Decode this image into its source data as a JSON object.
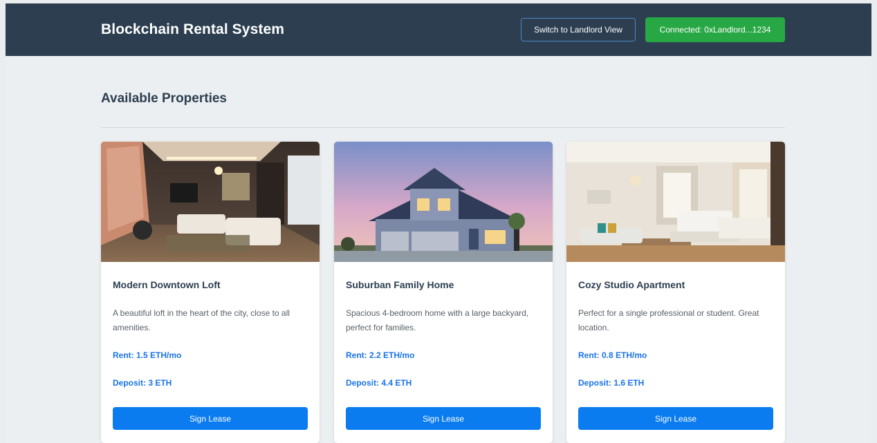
{
  "header": {
    "brand": "Blockchain Rental System",
    "switch_view_label": "Switch to Landlord View",
    "connection_status": "Connected: 0xLandlord...1234"
  },
  "main": {
    "section_title": "Available Properties",
    "properties": [
      {
        "title": "Modern Downtown Loft",
        "description": "A beautiful loft in the heart of the city, close to all amenities.",
        "rent": "Rent: 1.5 ETH/mo",
        "deposit": "Deposit: 3 ETH",
        "button_label": "Sign Lease",
        "image": "living-room-photo"
      },
      {
        "title": "Suburban Family Home",
        "description": "Spacious 4-bedroom home with a large backyard, perfect for families.",
        "rent": "Rent: 2.2 ETH/mo",
        "deposit": "Deposit: 4.4 ETH",
        "button_label": "Sign Lease",
        "image": "house-exterior-photo"
      },
      {
        "title": "Cozy Studio Apartment",
        "description": "Perfect for a single professional or student. Great location.",
        "rent": "Rent: 0.8 ETH/mo",
        "deposit": "Deposit: 1.6 ETH",
        "button_label": "Sign Lease",
        "image": "studio-bedroom-photo"
      }
    ]
  },
  "colors": {
    "navbar": "#2c3e50",
    "status_green": "#28a745",
    "accent_blue": "#1a73e8",
    "button_blue": "#0a7cf0",
    "page_bg": "#eceff1"
  }
}
